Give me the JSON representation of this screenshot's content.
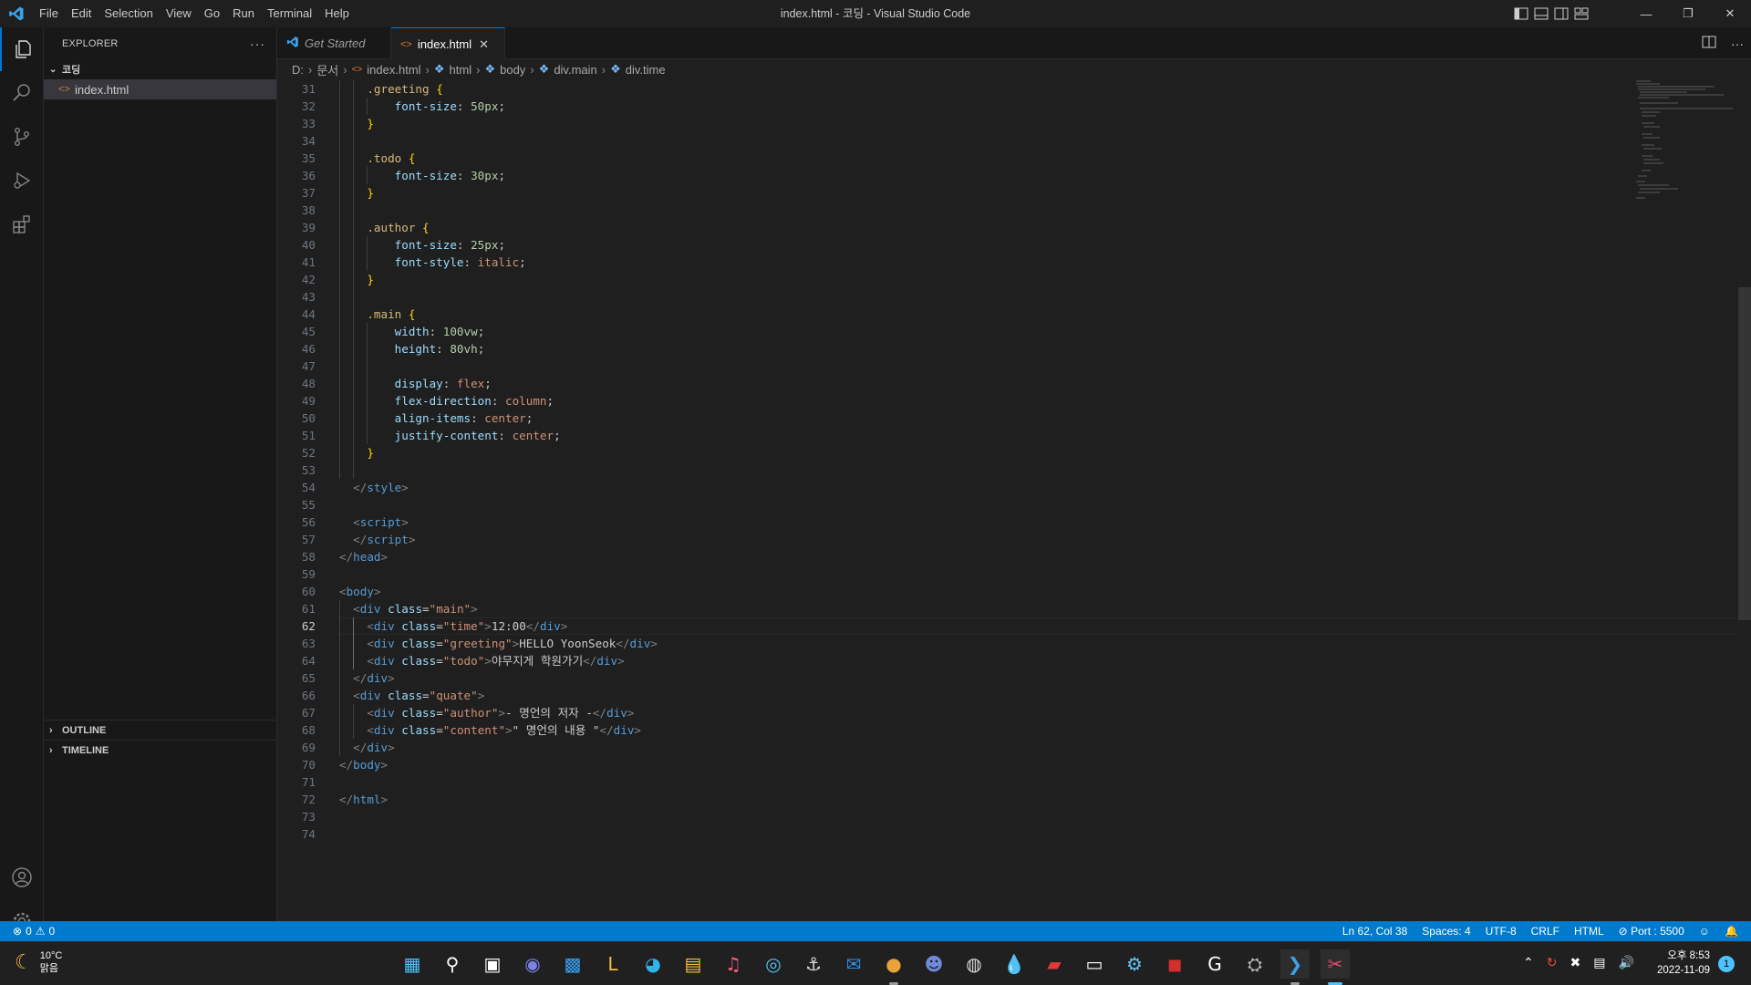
{
  "window": {
    "title": "index.html - 코딩 - Visual Studio Code"
  },
  "menu": [
    "File",
    "Edit",
    "Selection",
    "View",
    "Go",
    "Run",
    "Terminal",
    "Help"
  ],
  "sidebar": {
    "header": "EXPLORER",
    "folder": "코딩",
    "files": [
      "index.html"
    ],
    "outline": "OUTLINE",
    "timeline": "TIMELINE"
  },
  "tabs": [
    {
      "label": "Get Started",
      "active": false
    },
    {
      "label": "index.html",
      "active": true
    }
  ],
  "breadcrumb": [
    "D:",
    "문서",
    "index.html",
    "html",
    "body",
    "div.main",
    "div.time"
  ],
  "editor": {
    "first_line": 31,
    "current_line": 62,
    "lines": [
      [
        [
          "    ",
          "txt"
        ],
        [
          ".greeting",
          "key"
        ],
        [
          " ",
          "txt"
        ],
        [
          "{",
          "brace"
        ]
      ],
      [
        [
          "        ",
          "txt"
        ],
        [
          "font-size",
          "prop"
        ],
        [
          ": ",
          "txt"
        ],
        [
          "50px",
          "num"
        ],
        [
          ";",
          "txt"
        ]
      ],
      [
        [
          "    ",
          "txt"
        ],
        [
          "}",
          "brace"
        ]
      ],
      [
        [
          "",
          "txt"
        ]
      ],
      [
        [
          "    ",
          "txt"
        ],
        [
          ".todo",
          "key"
        ],
        [
          " ",
          "txt"
        ],
        [
          "{",
          "brace"
        ]
      ],
      [
        [
          "        ",
          "txt"
        ],
        [
          "font-size",
          "prop"
        ],
        [
          ": ",
          "txt"
        ],
        [
          "30px",
          "num"
        ],
        [
          ";",
          "txt"
        ]
      ],
      [
        [
          "    ",
          "txt"
        ],
        [
          "}",
          "brace"
        ]
      ],
      [
        [
          "",
          "txt"
        ]
      ],
      [
        [
          "    ",
          "txt"
        ],
        [
          ".author",
          "key"
        ],
        [
          " ",
          "txt"
        ],
        [
          "{",
          "brace"
        ]
      ],
      [
        [
          "        ",
          "txt"
        ],
        [
          "font-size",
          "prop"
        ],
        [
          ": ",
          "txt"
        ],
        [
          "25px",
          "num"
        ],
        [
          ";",
          "txt"
        ]
      ],
      [
        [
          "        ",
          "txt"
        ],
        [
          "font-style",
          "prop"
        ],
        [
          ": ",
          "txt"
        ],
        [
          "italic",
          "val"
        ],
        [
          ";",
          "txt"
        ]
      ],
      [
        [
          "    ",
          "txt"
        ],
        [
          "}",
          "brace"
        ]
      ],
      [
        [
          "",
          "txt"
        ]
      ],
      [
        [
          "    ",
          "txt"
        ],
        [
          ".main",
          "key"
        ],
        [
          " ",
          "txt"
        ],
        [
          "{",
          "brace"
        ]
      ],
      [
        [
          "        ",
          "txt"
        ],
        [
          "width",
          "prop"
        ],
        [
          ": ",
          "txt"
        ],
        [
          "100vw",
          "num"
        ],
        [
          ";",
          "txt"
        ]
      ],
      [
        [
          "        ",
          "txt"
        ],
        [
          "height",
          "prop"
        ],
        [
          ": ",
          "txt"
        ],
        [
          "80vh",
          "num"
        ],
        [
          ";",
          "txt"
        ]
      ],
      [
        [
          "",
          "txt"
        ]
      ],
      [
        [
          "        ",
          "txt"
        ],
        [
          "display",
          "prop"
        ],
        [
          ": ",
          "txt"
        ],
        [
          "flex",
          "val"
        ],
        [
          ";",
          "txt"
        ]
      ],
      [
        [
          "        ",
          "txt"
        ],
        [
          "flex-direction",
          "prop"
        ],
        [
          ": ",
          "txt"
        ],
        [
          "column",
          "val"
        ],
        [
          ";",
          "txt"
        ]
      ],
      [
        [
          "        ",
          "txt"
        ],
        [
          "align-items",
          "prop"
        ],
        [
          ": ",
          "txt"
        ],
        [
          "center",
          "val"
        ],
        [
          ";",
          "txt"
        ]
      ],
      [
        [
          "        ",
          "txt"
        ],
        [
          "justify-content",
          "prop"
        ],
        [
          ": ",
          "txt"
        ],
        [
          "center",
          "val"
        ],
        [
          ";",
          "txt"
        ]
      ],
      [
        [
          "    ",
          "txt"
        ],
        [
          "}",
          "brace"
        ]
      ],
      [
        [
          "",
          "txt"
        ]
      ],
      [
        [
          "  ",
          "txt"
        ],
        [
          "</",
          "gray"
        ],
        [
          "style",
          "tag"
        ],
        [
          ">",
          "gray"
        ]
      ],
      [
        [
          "",
          "txt"
        ]
      ],
      [
        [
          "  ",
          "txt"
        ],
        [
          "<",
          "gray"
        ],
        [
          "script",
          "tag"
        ],
        [
          ">",
          "gray"
        ]
      ],
      [
        [
          "  ",
          "txt"
        ],
        [
          "</",
          "gray"
        ],
        [
          "script",
          "tag"
        ],
        [
          ">",
          "gray"
        ]
      ],
      [
        [
          "</",
          "gray"
        ],
        [
          "head",
          "tag"
        ],
        [
          ">",
          "gray"
        ]
      ],
      [
        [
          "",
          "txt"
        ]
      ],
      [
        [
          "<",
          "gray"
        ],
        [
          "body",
          "tag"
        ],
        [
          ">",
          "gray"
        ]
      ],
      [
        [
          "  ",
          "txt"
        ],
        [
          "<",
          "gray"
        ],
        [
          "div",
          "tag"
        ],
        [
          " ",
          "txt"
        ],
        [
          "class",
          "prop"
        ],
        [
          "=",
          "txt"
        ],
        [
          "\"main\"",
          "str"
        ],
        [
          ">",
          "gray"
        ]
      ],
      [
        [
          "    ",
          "txt"
        ],
        [
          "<",
          "gray"
        ],
        [
          "div",
          "tag"
        ],
        [
          " ",
          "txt"
        ],
        [
          "class",
          "prop"
        ],
        [
          "=",
          "txt"
        ],
        [
          "\"time\"",
          "str"
        ],
        [
          ">",
          "gray"
        ],
        [
          "12:00",
          "txt"
        ],
        [
          "</",
          "gray"
        ],
        [
          "div",
          "tag"
        ],
        [
          ">",
          "gray"
        ]
      ],
      [
        [
          "    ",
          "txt"
        ],
        [
          "<",
          "gray"
        ],
        [
          "div",
          "tag"
        ],
        [
          " ",
          "txt"
        ],
        [
          "class",
          "prop"
        ],
        [
          "=",
          "txt"
        ],
        [
          "\"greeting\"",
          "str"
        ],
        [
          ">",
          "gray"
        ],
        [
          "HELLO YoonSeok",
          "txt"
        ],
        [
          "</",
          "gray"
        ],
        [
          "div",
          "tag"
        ],
        [
          ">",
          "gray"
        ]
      ],
      [
        [
          "    ",
          "txt"
        ],
        [
          "<",
          "gray"
        ],
        [
          "div",
          "tag"
        ],
        [
          " ",
          "txt"
        ],
        [
          "class",
          "prop"
        ],
        [
          "=",
          "txt"
        ],
        [
          "\"todo\"",
          "str"
        ],
        [
          ">",
          "gray"
        ],
        [
          "야무지게 학원가기",
          "txt"
        ],
        [
          "</",
          "gray"
        ],
        [
          "div",
          "tag"
        ],
        [
          ">",
          "gray"
        ]
      ],
      [
        [
          "  ",
          "txt"
        ],
        [
          "</",
          "gray"
        ],
        [
          "div",
          "tag"
        ],
        [
          ">",
          "gray"
        ]
      ],
      [
        [
          "  ",
          "txt"
        ],
        [
          "<",
          "gray"
        ],
        [
          "div",
          "tag"
        ],
        [
          " ",
          "txt"
        ],
        [
          "class",
          "prop"
        ],
        [
          "=",
          "txt"
        ],
        [
          "\"quate\"",
          "str"
        ],
        [
          ">",
          "gray"
        ]
      ],
      [
        [
          "    ",
          "txt"
        ],
        [
          "<",
          "gray"
        ],
        [
          "div",
          "tag"
        ],
        [
          " ",
          "txt"
        ],
        [
          "class",
          "prop"
        ],
        [
          "=",
          "txt"
        ],
        [
          "\"author\"",
          "str"
        ],
        [
          ">",
          "gray"
        ],
        [
          "- 명언의 저자 -",
          "txt"
        ],
        [
          "</",
          "gray"
        ],
        [
          "div",
          "tag"
        ],
        [
          ">",
          "gray"
        ]
      ],
      [
        [
          "    ",
          "txt"
        ],
        [
          "<",
          "gray"
        ],
        [
          "div",
          "tag"
        ],
        [
          " ",
          "txt"
        ],
        [
          "class",
          "prop"
        ],
        [
          "=",
          "txt"
        ],
        [
          "\"content\"",
          "str"
        ],
        [
          ">",
          "gray"
        ],
        [
          "\" 명언의 내용 \"",
          "txt"
        ],
        [
          "</",
          "gray"
        ],
        [
          "div",
          "tag"
        ],
        [
          ">",
          "gray"
        ]
      ],
      [
        [
          "  ",
          "txt"
        ],
        [
          "</",
          "gray"
        ],
        [
          "div",
          "tag"
        ],
        [
          ">",
          "gray"
        ]
      ],
      [
        [
          "</",
          "gray"
        ],
        [
          "body",
          "tag"
        ],
        [
          ">",
          "gray"
        ]
      ],
      [
        [
          "",
          "txt"
        ]
      ],
      [
        [
          "</",
          "gray"
        ],
        [
          "html",
          "tag"
        ],
        [
          ">",
          "gray"
        ]
      ],
      [
        [
          "",
          "txt"
        ]
      ],
      [
        [
          "",
          "txt"
        ]
      ]
    ]
  },
  "status": {
    "errors": "0",
    "warnings": "0",
    "position": "Ln 62, Col 38",
    "spaces": "Spaces: 4",
    "encoding": "UTF-8",
    "eol": "CRLF",
    "language": "HTML",
    "port": "Port : 5500"
  },
  "taskbar": {
    "weather_temp": "10°C",
    "weather_desc": "맑음",
    "time": "오후 8:53",
    "date": "2022-11-09",
    "notification_count": "1",
    "apps": [
      "start-icon",
      "search-icon",
      "task-view-icon",
      "chat-icon",
      "store-icon",
      "app-l-icon",
      "edge-icon",
      "file-explorer-icon",
      "music-icon",
      "app-globe-icon",
      "app-ship-icon",
      "mail-icon",
      "chrome-icon",
      "discord-icon",
      "app-circle-icon",
      "app-drop-icon",
      "app-red-icon",
      "notepad-icon",
      "steam-icon",
      "app-cube-icon",
      "app-g-icon",
      "app-gear-icon",
      "vscode-icon",
      "snipping-icon"
    ]
  },
  "colors": {
    "accent": "#007acc",
    "status_bar": "#007acc",
    "tab_active_border": "#0078d4"
  }
}
